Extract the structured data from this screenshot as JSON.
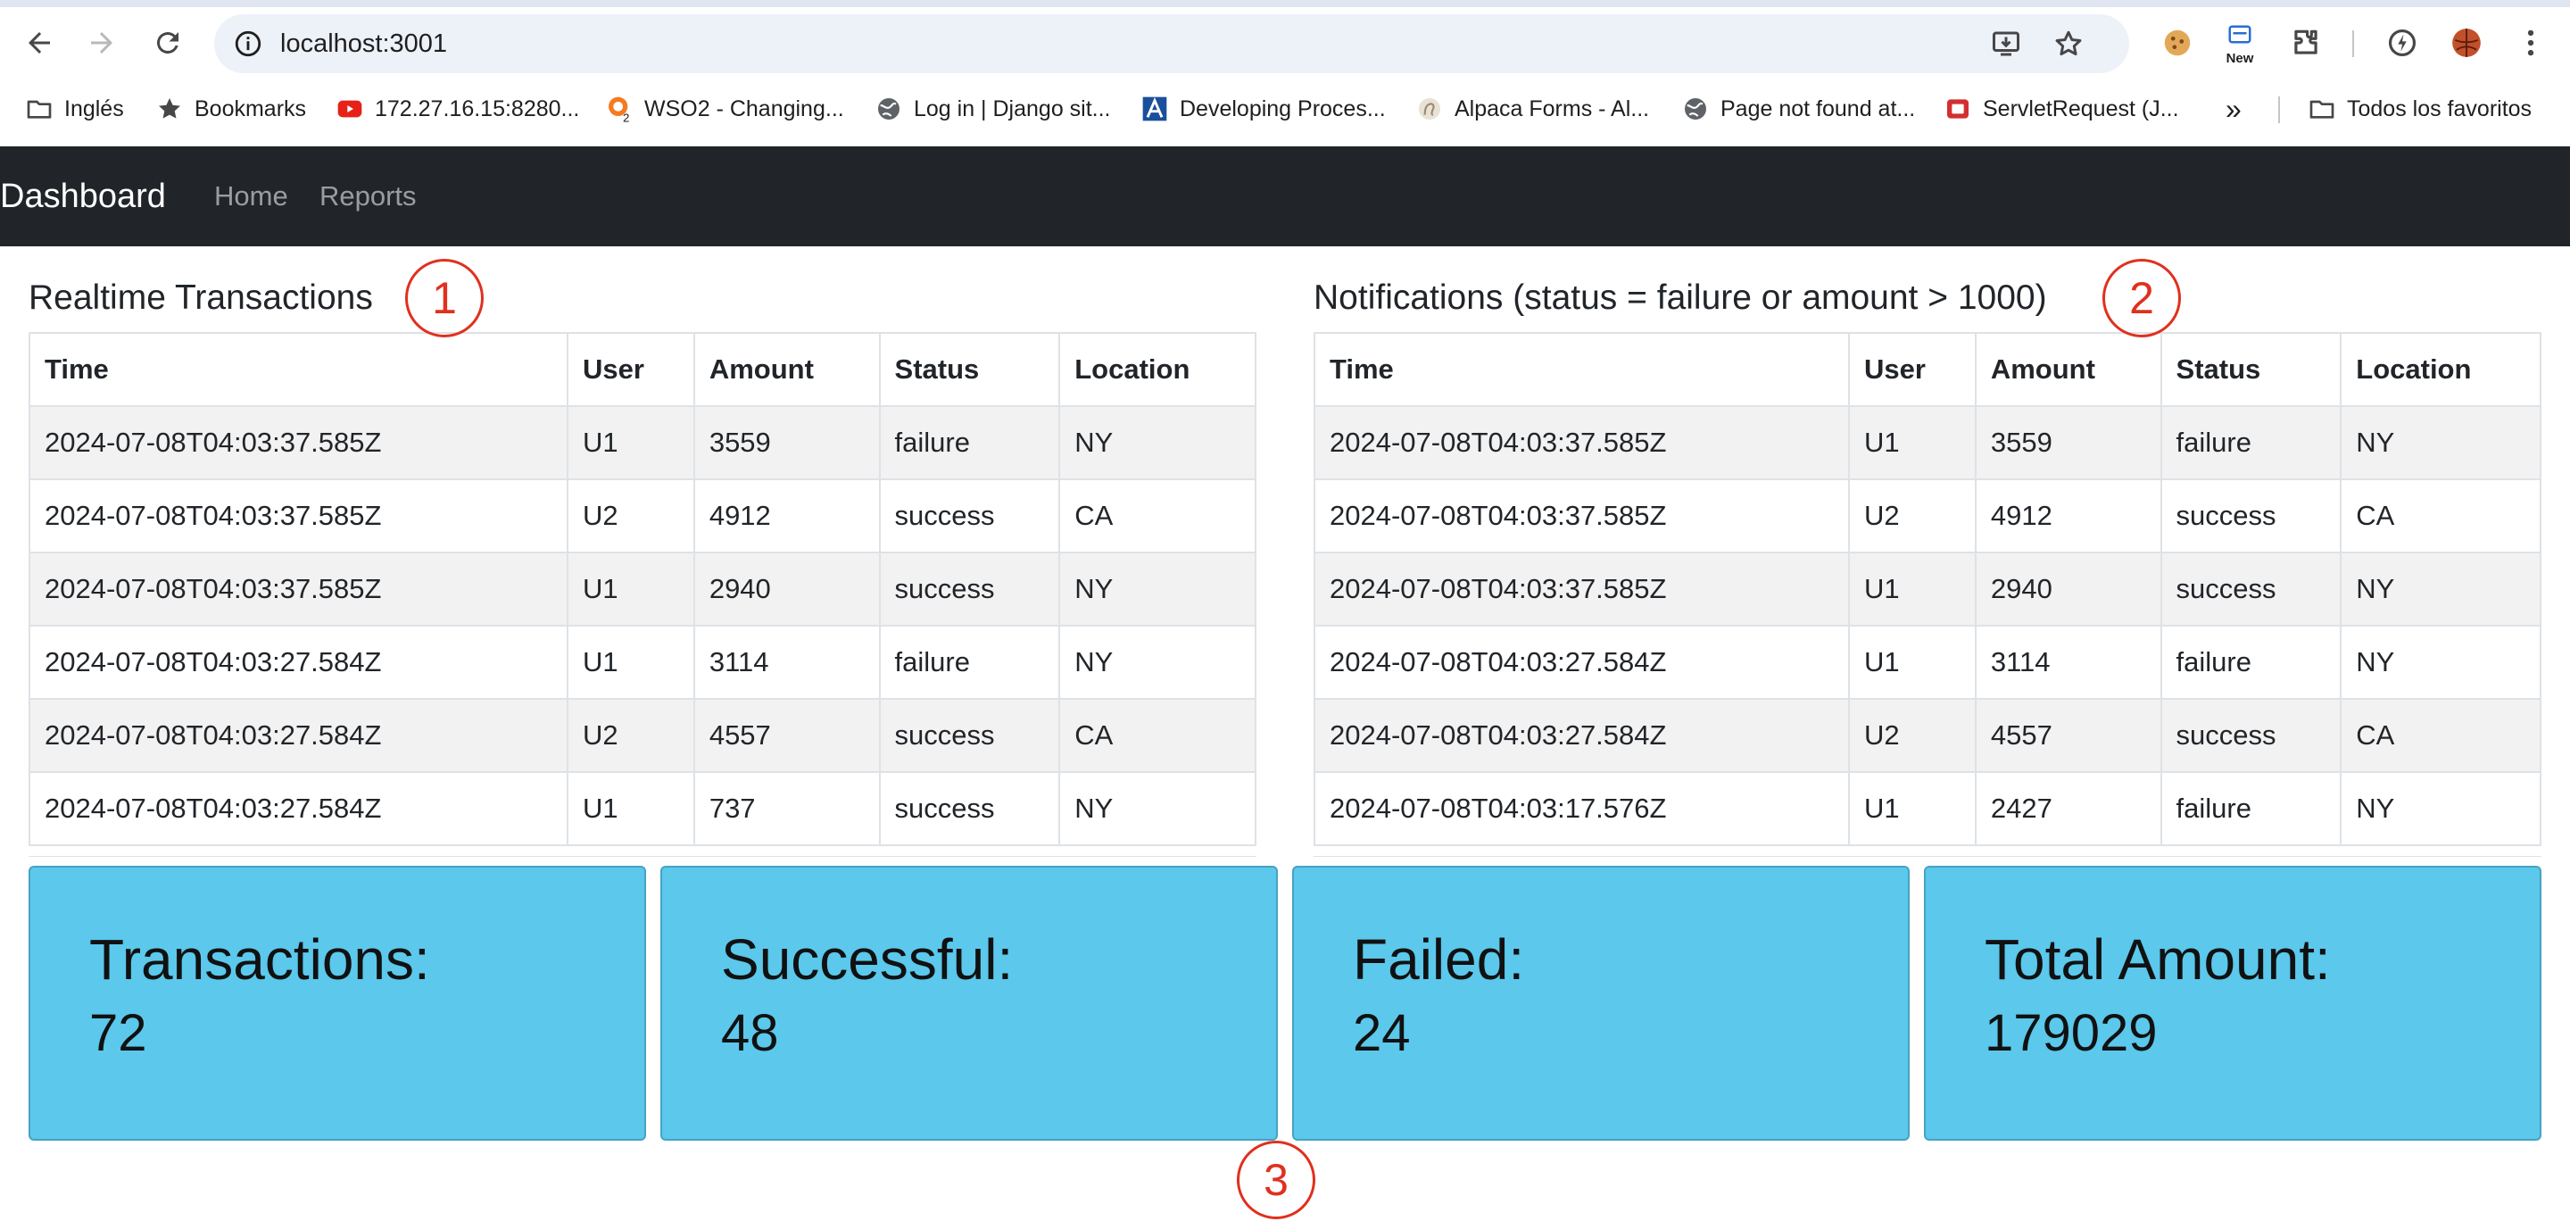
{
  "browser": {
    "url": "localhost:3001",
    "new_badge": "New",
    "bookmarks": [
      {
        "label": "Inglés",
        "icon": "folder-icon"
      },
      {
        "label": "Bookmarks",
        "icon": "star-icon"
      },
      {
        "label": "172.27.16.15:8280...",
        "icon": "youtube-icon"
      },
      {
        "label": "WSO2 - Changing...",
        "icon": "wso2-icon"
      },
      {
        "label": "Log in | Django sit...",
        "icon": "globe-icon"
      },
      {
        "label": "Developing Proces...",
        "icon": "alpaca-a-icon"
      },
      {
        "label": "Alpaca Forms - Al...",
        "icon": "alpaca-forms-icon"
      },
      {
        "label": "Page not found at...",
        "icon": "globe-icon"
      },
      {
        "label": "ServletRequest (J...",
        "icon": "servlet-icon"
      }
    ],
    "more_bookmarks": "»",
    "all_bookmarks": "Todos los favoritos"
  },
  "navbar": {
    "brand": "Dashboard",
    "links": [
      "Home",
      "Reports"
    ]
  },
  "transactions_panel": {
    "title": "Realtime Transactions",
    "columns": [
      "Time",
      "User",
      "Amount",
      "Status",
      "Location"
    ],
    "rows": [
      [
        "2024-07-08T04:03:37.585Z",
        "U1",
        "3559",
        "failure",
        "NY"
      ],
      [
        "2024-07-08T04:03:37.585Z",
        "U2",
        "4912",
        "success",
        "CA"
      ],
      [
        "2024-07-08T04:03:37.585Z",
        "U1",
        "2940",
        "success",
        "NY"
      ],
      [
        "2024-07-08T04:03:27.584Z",
        "U1",
        "3114",
        "failure",
        "NY"
      ],
      [
        "2024-07-08T04:03:27.584Z",
        "U2",
        "4557",
        "success",
        "CA"
      ],
      [
        "2024-07-08T04:03:27.584Z",
        "U1",
        "737",
        "success",
        "NY"
      ]
    ]
  },
  "notifications_panel": {
    "title": "Notifications (status = failure or amount > 1000)",
    "columns": [
      "Time",
      "User",
      "Amount",
      "Status",
      "Location"
    ],
    "rows": [
      [
        "2024-07-08T04:03:37.585Z",
        "U1",
        "3559",
        "failure",
        "NY"
      ],
      [
        "2024-07-08T04:03:37.585Z",
        "U2",
        "4912",
        "success",
        "CA"
      ],
      [
        "2024-07-08T04:03:37.585Z",
        "U1",
        "2940",
        "success",
        "NY"
      ],
      [
        "2024-07-08T04:03:27.584Z",
        "U1",
        "3114",
        "failure",
        "NY"
      ],
      [
        "2024-07-08T04:03:27.584Z",
        "U2",
        "4557",
        "success",
        "CA"
      ],
      [
        "2024-07-08T04:03:17.576Z",
        "U1",
        "2427",
        "failure",
        "NY"
      ]
    ]
  },
  "annotations": [
    "1",
    "2",
    "3"
  ],
  "stats": [
    {
      "label": "Transactions:",
      "value": "72"
    },
    {
      "label": "Successful:",
      "value": "48"
    },
    {
      "label": "Failed:",
      "value": "24"
    },
    {
      "label": "Total Amount:",
      "value": "179029"
    }
  ],
  "colors": {
    "navbar_bg": "#212529",
    "card_bg": "#5bc8ec",
    "annotation": "#e0301e",
    "stripe": "#f2f2f2"
  }
}
